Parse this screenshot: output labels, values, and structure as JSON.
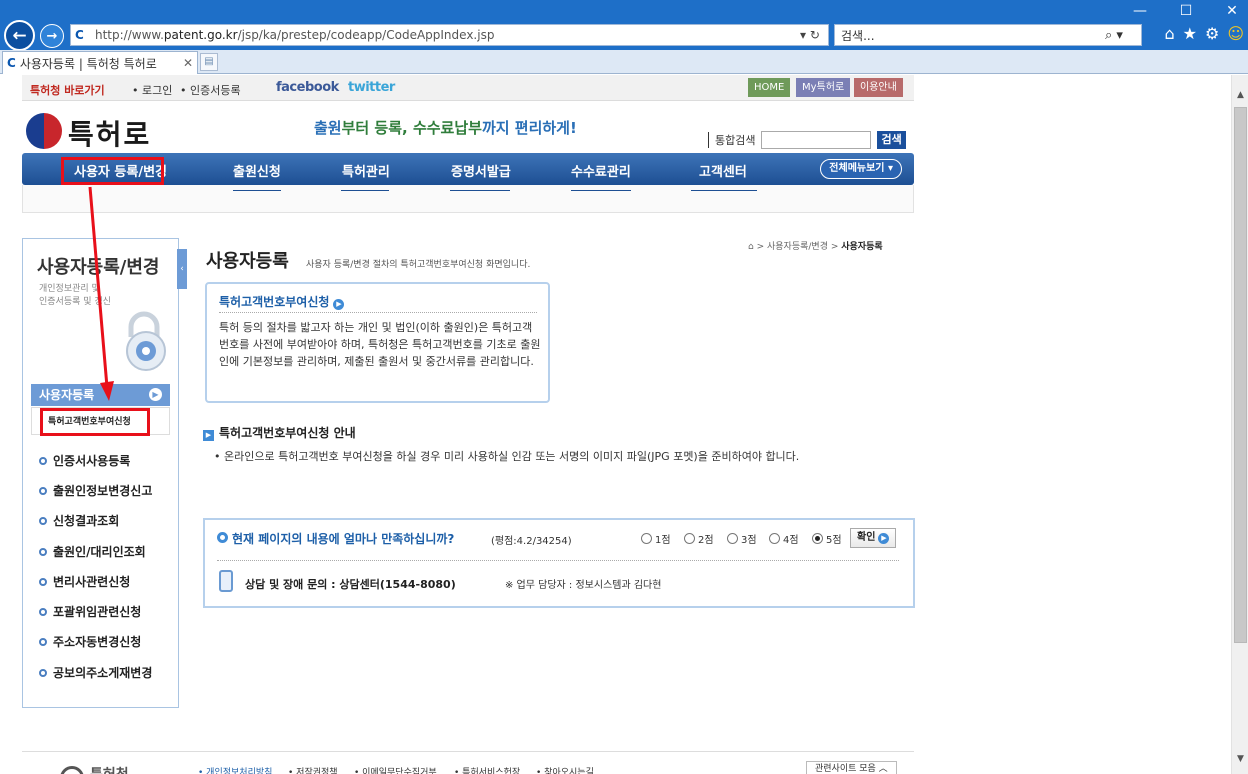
{
  "browser": {
    "url_prefix": "http://www.",
    "url_domain": "patent.go.kr",
    "url_path": "/jsp/ka/prestep/codeapp/CodeAppIndex.jsp",
    "address_controls": "▾ ↻",
    "search_placeholder": "검색...",
    "search_controls": "⌕ ▾",
    "tab_title": "사용자등록 | 특허청 특허로",
    "tab_close": "✕",
    "win_min": "—",
    "win_max": "☐",
    "win_close": "✕",
    "home_glyph": "⌂",
    "fav_glyph": "★",
    "tools_glyph": "⚙",
    "smile_glyph": "☺",
    "back_glyph": "←",
    "fwd_glyph": "→"
  },
  "site": {
    "util": {
      "kipo_link": "특허청 바로가기",
      "login": "• 로그인",
      "cert": "• 인증서등록",
      "facebook": "facebook",
      "twitter": "twitter",
      "home": "HOME",
      "my": "My특허로",
      "info": "이용안내"
    },
    "logo_text": "특허로",
    "slogan_a": "출원",
    "slogan_b": "부터 등록, 수수료납부",
    "slogan_c": "까지 편리하게!",
    "search_label": "통합검색",
    "search_button": "검색",
    "gnb": [
      "사용자 등록/변경",
      "출원신청",
      "특허관리",
      "증명서발급",
      "수수료관리",
      "고객센터"
    ],
    "all_menu": "전체메뉴보기 ▾",
    "lnb": {
      "title": "사용자등록/변경",
      "desc_1": "개인정보관리 및",
      "desc_2": "인증서등록 및 갱신",
      "current": "사용자등록",
      "current_sub": "특허고객번호부여신청",
      "items": [
        "인증서사용등록",
        "출원인정보변경신고",
        "신청결과조회",
        "출원인/대리인조회",
        "변리사관련신청",
        "포괄위임관련신청",
        "주소자동변경신청",
        "공보의주소게재변경"
      ]
    },
    "breadcrumb_mid": "> 사용자등록/변경 >",
    "breadcrumb_cur": "사용자등록",
    "page_title": "사용자등록",
    "page_sub": "사용자 등록/변경 절차의 특허고객번호부여신청 화면입니다.",
    "info_box": {
      "title": "특허고객번호부여신청",
      "body": "특허 등의 절차를 밟고자 하는 개인 및 법인(이하 출원인)은 특허고객번호를 사전에 부여받아야 하며, 특허청은 특허고객번호를 기초로 출원인에 기본정보를 관리하며, 제출된 출원서 및 중간서류를 관리합니다."
    },
    "guide": {
      "title": "특허고객번호부여신청 안내",
      "body": "• 온라인으로 특허고객번호 부여신청을 하실 경우 미리 사용하실 인감 또는 서명의 이미지 파일(JPG 포멧)을 준비하여야 합니다."
    },
    "survey": {
      "question": "현재 페이지의 내용에 얼마나 만족하십니까?",
      "average": "(평점:4.2/34254)",
      "options": [
        "1점",
        "2점",
        "3점",
        "4점",
        "5점"
      ],
      "selected_index": 4,
      "confirm": "확인",
      "contact": "상담 및 장애 문의 : 상담센터(1544-8080)",
      "staff": "※ 업무 담당자 : 정보시스템과 김다현"
    },
    "footer": {
      "logo_text": "특허청",
      "links": [
        "• 개인정보처리방침",
        "• 저작권정책",
        "• 이메일무단수집거부",
        "• 특허서비스헌장",
        "• 찾아오시는길"
      ],
      "related": "관련사이트 모음 ︿"
    }
  },
  "colors": {
    "chrome": "#1e6fc8",
    "gnb": "#1d4f93",
    "accent": "#3f8bd6",
    "annotation": "#e8101a"
  }
}
